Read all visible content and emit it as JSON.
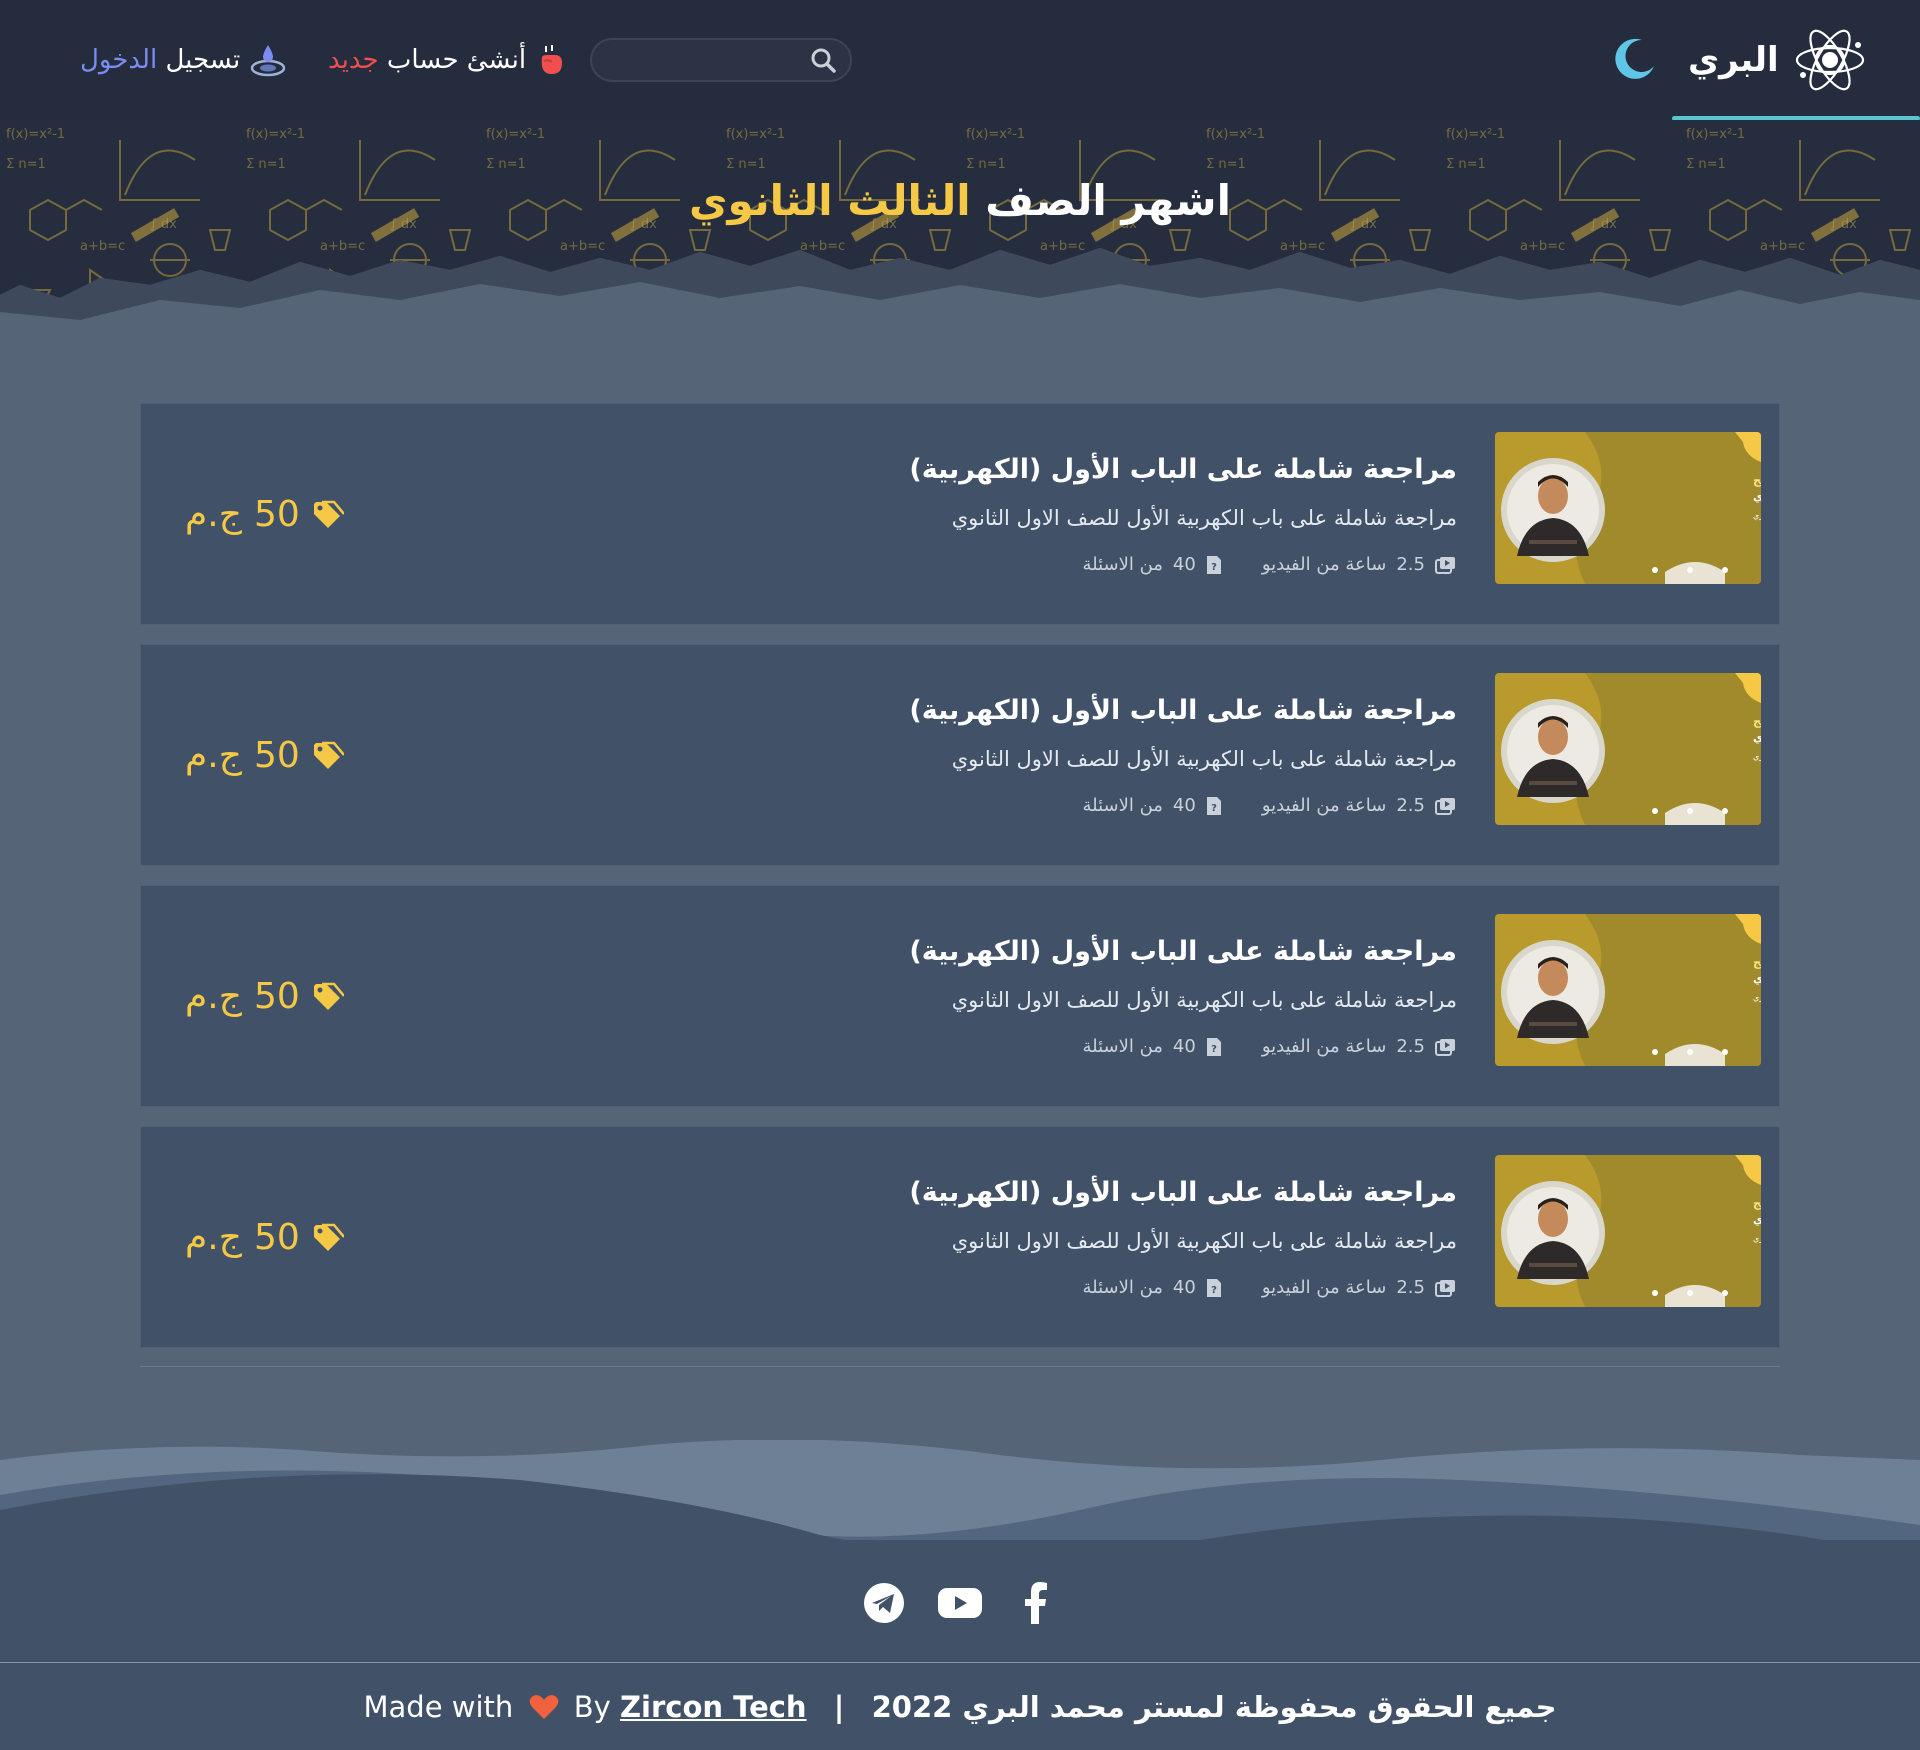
{
  "header": {
    "logo_text": "البري",
    "search": {
      "placeholder": "",
      "value": ""
    },
    "register": {
      "prefix": "أنشئ حساب",
      "highlight": "جديد"
    },
    "login": {
      "prefix": "تسجيل",
      "highlight": "الدخول"
    }
  },
  "hero": {
    "title_part1": "اشهر الصف",
    "title_highlight": "الثالث الثانوي"
  },
  "courses": [
    {
      "title": "مراجعة شاملة على الباب الأول (الكهربية)",
      "description": "مراجعة شاملة على باب الكهربية الأول للصف الاول الثانوي",
      "video_hours": "2.5",
      "video_label": "ساعة من الفيديو",
      "questions_count": "40",
      "questions_label": "من الاسئلة",
      "price": "50",
      "currency": "ج.م"
    },
    {
      "title": "مراجعة شاملة على الباب الأول (الكهربية)",
      "description": "مراجعة شاملة على باب الكهربية الأول للصف الاول الثانوي",
      "video_hours": "2.5",
      "video_label": "ساعة من الفيديو",
      "questions_count": "40",
      "questions_label": "من الاسئلة",
      "price": "50",
      "currency": "ج.م"
    },
    {
      "title": "مراجعة شاملة على الباب الأول (الكهربية)",
      "description": "مراجعة شاملة على باب الكهربية الأول للصف الاول الثانوي",
      "video_hours": "2.5",
      "video_label": "ساعة من الفيديو",
      "questions_count": "40",
      "questions_label": "من الاسئلة",
      "price": "50",
      "currency": "ج.م"
    },
    {
      "title": "مراجعة شاملة على الباب الأول (الكهربية)",
      "description": "مراجعة شاملة على باب الكهربية الأول للصف الاول الثانوي",
      "video_hours": "2.5",
      "video_label": "ساعة من الفيديو",
      "questions_count": "40",
      "questions_label": "من الاسئلة",
      "price": "50",
      "currency": "ج.م"
    }
  ],
  "thumbnail": {
    "title_line1": "مراجعة شاملة على المنهج",
    "title_line2": "للصف الثالث الثانوي",
    "teacher": "أ محمد البري"
  },
  "footer": {
    "socials": [
      "telegram-icon",
      "youtube-icon",
      "facebook-icon"
    ],
    "copyright_ar": "جميع الحقوق محفوظة لمستر محمد البري 2022",
    "separator": "|",
    "made_with": "Made with",
    "by": "By",
    "brand": "Zircon Tech"
  },
  "colors": {
    "header_bg": "#252c3d",
    "page_bg": "#566477",
    "card_bg": "#415268",
    "accent_yellow": "#f5c845",
    "accent_teal": "#5cc6cf",
    "accent_red": "#ef4f4f",
    "accent_blue": "#7b8cf0"
  }
}
